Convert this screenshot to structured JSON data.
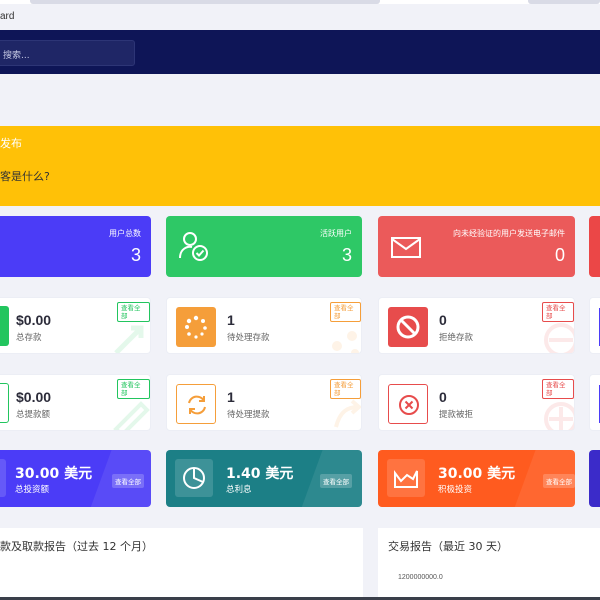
{
  "breadcrumb": "ard",
  "search": {
    "placeholder": "搜索..."
  },
  "announcement": {
    "title": "发布",
    "question": "客是什么?"
  },
  "stats": [
    {
      "label": "用户总数",
      "value": "3",
      "color": "#4b3cf7"
    },
    {
      "label": "活跃用户",
      "value": "3",
      "color": "#2ec866"
    },
    {
      "label": "向未经验证的用户发送电子邮件",
      "value": "0",
      "color": "#eb5a5a"
    }
  ],
  "view_all": "查看全部",
  "deposits": [
    {
      "amount": "$0.00",
      "label": "总存款",
      "accent": "#22c55e"
    },
    {
      "amount": "1",
      "label": "待处理存款",
      "accent": "#f59e3a"
    },
    {
      "amount": "0",
      "label": "拒绝存款",
      "accent": "#e74c4c"
    }
  ],
  "withdrawals": [
    {
      "amount": "$0.00",
      "label": "总提款额",
      "accent": "#22c55e"
    },
    {
      "amount": "1",
      "label": "待处理提款",
      "accent": "#f59e3a"
    },
    {
      "amount": "0",
      "label": "提款被拒",
      "accent": "#e74c4c"
    }
  ],
  "investments": [
    {
      "amount": "30.00 美元",
      "label": "总投资额",
      "color": "#4b3cf7"
    },
    {
      "amount": "1.40 美元",
      "label": "总利息",
      "color": "#1c7f86"
    },
    {
      "amount": "30.00 美元",
      "label": "积极投资",
      "color": "#ff5b1f"
    }
  ],
  "reports": {
    "deposit_withdraw_title": "款及取款报告（过去 12 个月）",
    "transaction_title": "交易报告（最近 30 天）",
    "axis_value": "1200000000.0"
  }
}
